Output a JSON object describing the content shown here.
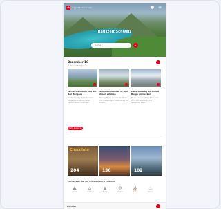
{
  "hero": {
    "brand": "myswitzerland.com",
    "title": "Rauszeit Schweiz",
    "search_placeholder": "Suche",
    "search_icon": "search-icon",
    "menu_icons": [
      "user-icon",
      "menu-icon"
    ]
  },
  "date_section": {
    "title": "Dezember 16",
    "subtitle": "Veranstaltungen"
  },
  "articles": [
    {
      "title": "Winterwandern rund um den Bergsee",
      "text": "Entdecken Sie die schönsten Wege durch verschneite Landschaften und Täler."
    },
    {
      "title": "Schneeschuhtour in den Alpen erleben",
      "text": "Ruhige Pfade abseits der Pisten mit grossartiger Aussicht auf die Gipfel."
    },
    {
      "title": "Panoramazug durch die Berge entdecken",
      "text": "Eine unvergessliche Reise mit Blick auf Gletscher und glitzernde Seen."
    }
  ],
  "more_button": "Mehr anzeigen",
  "tiles": [
    {
      "tag": "Chocolate",
      "number": "204"
    },
    {
      "tag": "",
      "number": "136"
    },
    {
      "tag": "",
      "number": "102"
    }
  ],
  "categories_title": "Entdecken Sie die Schweiz nach Themen",
  "categories": [
    {
      "icon": "hiking-icon",
      "glyph": "⛰",
      "label": "Natur"
    },
    {
      "icon": "city-icon",
      "glyph": "⌂",
      "label": "Städte"
    },
    {
      "icon": "mountain-icon",
      "glyph": "▲",
      "label": "Berge"
    },
    {
      "icon": "ski-icon",
      "glyph": "❄",
      "label": "Winter"
    },
    {
      "icon": "culture-icon",
      "glyph": "⛪",
      "label": "Kultur"
    },
    {
      "icon": "food-icon",
      "glyph": "♨",
      "label": "Genuss"
    }
  ],
  "footer": {
    "title": "Kontakt"
  },
  "colors": {
    "brand_red": "#e2001a",
    "lake": "#2aa3b3"
  }
}
